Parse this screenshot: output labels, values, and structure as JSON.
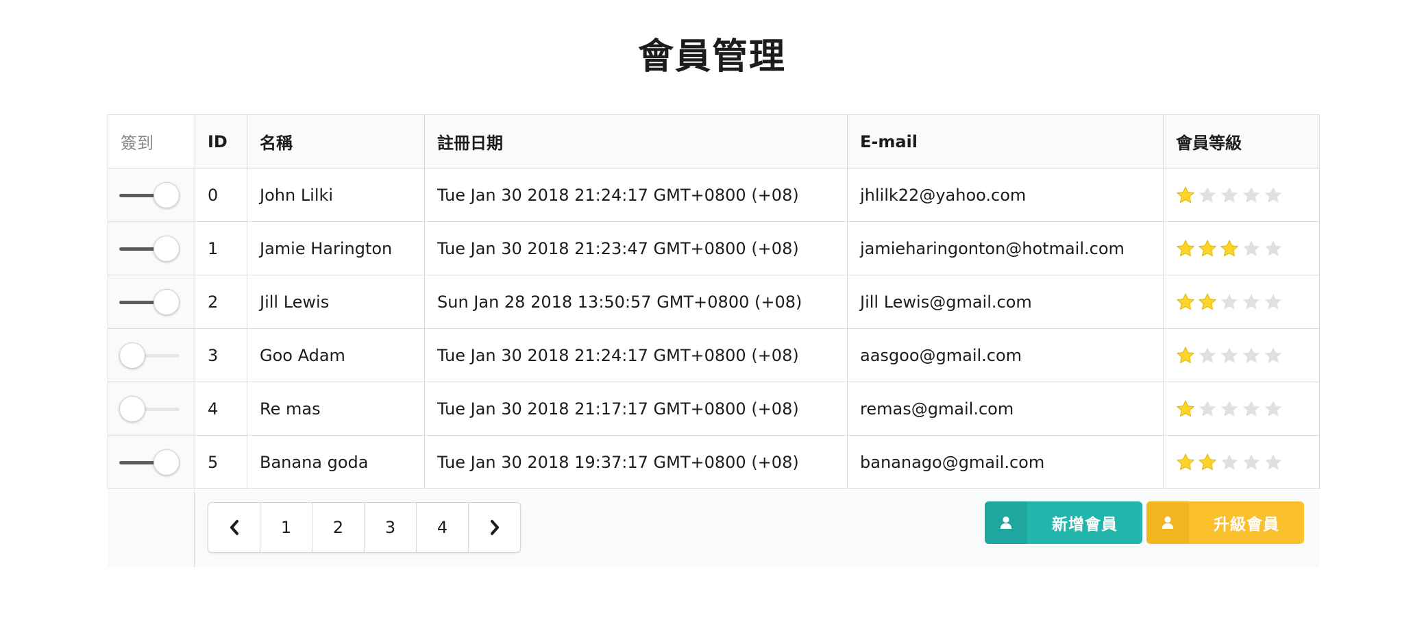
{
  "page": {
    "title": "會員管理"
  },
  "table": {
    "headers": {
      "checkin": "簽到",
      "id": "ID",
      "name": "名稱",
      "date": "註冊日期",
      "email": "E-mail",
      "level": "會員等級"
    },
    "rows": [
      {
        "checked_in": true,
        "id": "0",
        "name": "John Lilki",
        "date": "Tue Jan 30 2018 21:24:17 GMT+0800 (+08)",
        "email": "jhlilk22@yahoo.com",
        "stars": 1
      },
      {
        "checked_in": true,
        "id": "1",
        "name": "Jamie Harington",
        "date": "Tue Jan 30 2018 21:23:47 GMT+0800 (+08)",
        "email": "jamieharingonton@hotmail.com",
        "stars": 3
      },
      {
        "checked_in": true,
        "id": "2",
        "name": "Jill Lewis",
        "date": "Sun Jan 28 2018 13:50:57 GMT+0800 (+08)",
        "email": "Jill Lewis@gmail.com",
        "stars": 2
      },
      {
        "checked_in": false,
        "id": "3",
        "name": "Goo Adam",
        "date": "Tue Jan 30 2018 21:24:17 GMT+0800 (+08)",
        "email": "aasgoo@gmail.com",
        "stars": 1
      },
      {
        "checked_in": false,
        "id": "4",
        "name": "Re mas",
        "date": "Tue Jan 30 2018 21:17:17 GMT+0800 (+08)",
        "email": "remas@gmail.com",
        "stars": 1
      },
      {
        "checked_in": true,
        "id": "5",
        "name": "Banana goda",
        "date": "Tue Jan 30 2018 19:37:17 GMT+0800 (+08)",
        "email": "bananago@gmail.com",
        "stars": 2
      }
    ],
    "max_stars": 5
  },
  "pagination": {
    "prev_icon": "chevron-left-icon",
    "pages": [
      "1",
      "2",
      "3",
      "4"
    ],
    "next_icon": "chevron-right-icon"
  },
  "actions": {
    "add_label": "新增會員",
    "add_icon": "user-icon",
    "upgrade_label": "升級會員",
    "upgrade_icon": "user-icon"
  },
  "colors": {
    "add_button": "#21b5ab",
    "upgrade_button": "#fbc02d",
    "star_filled": "#fbd52c",
    "star_empty": "#e0e0e0",
    "toggle_on": "#5c5c5c"
  }
}
